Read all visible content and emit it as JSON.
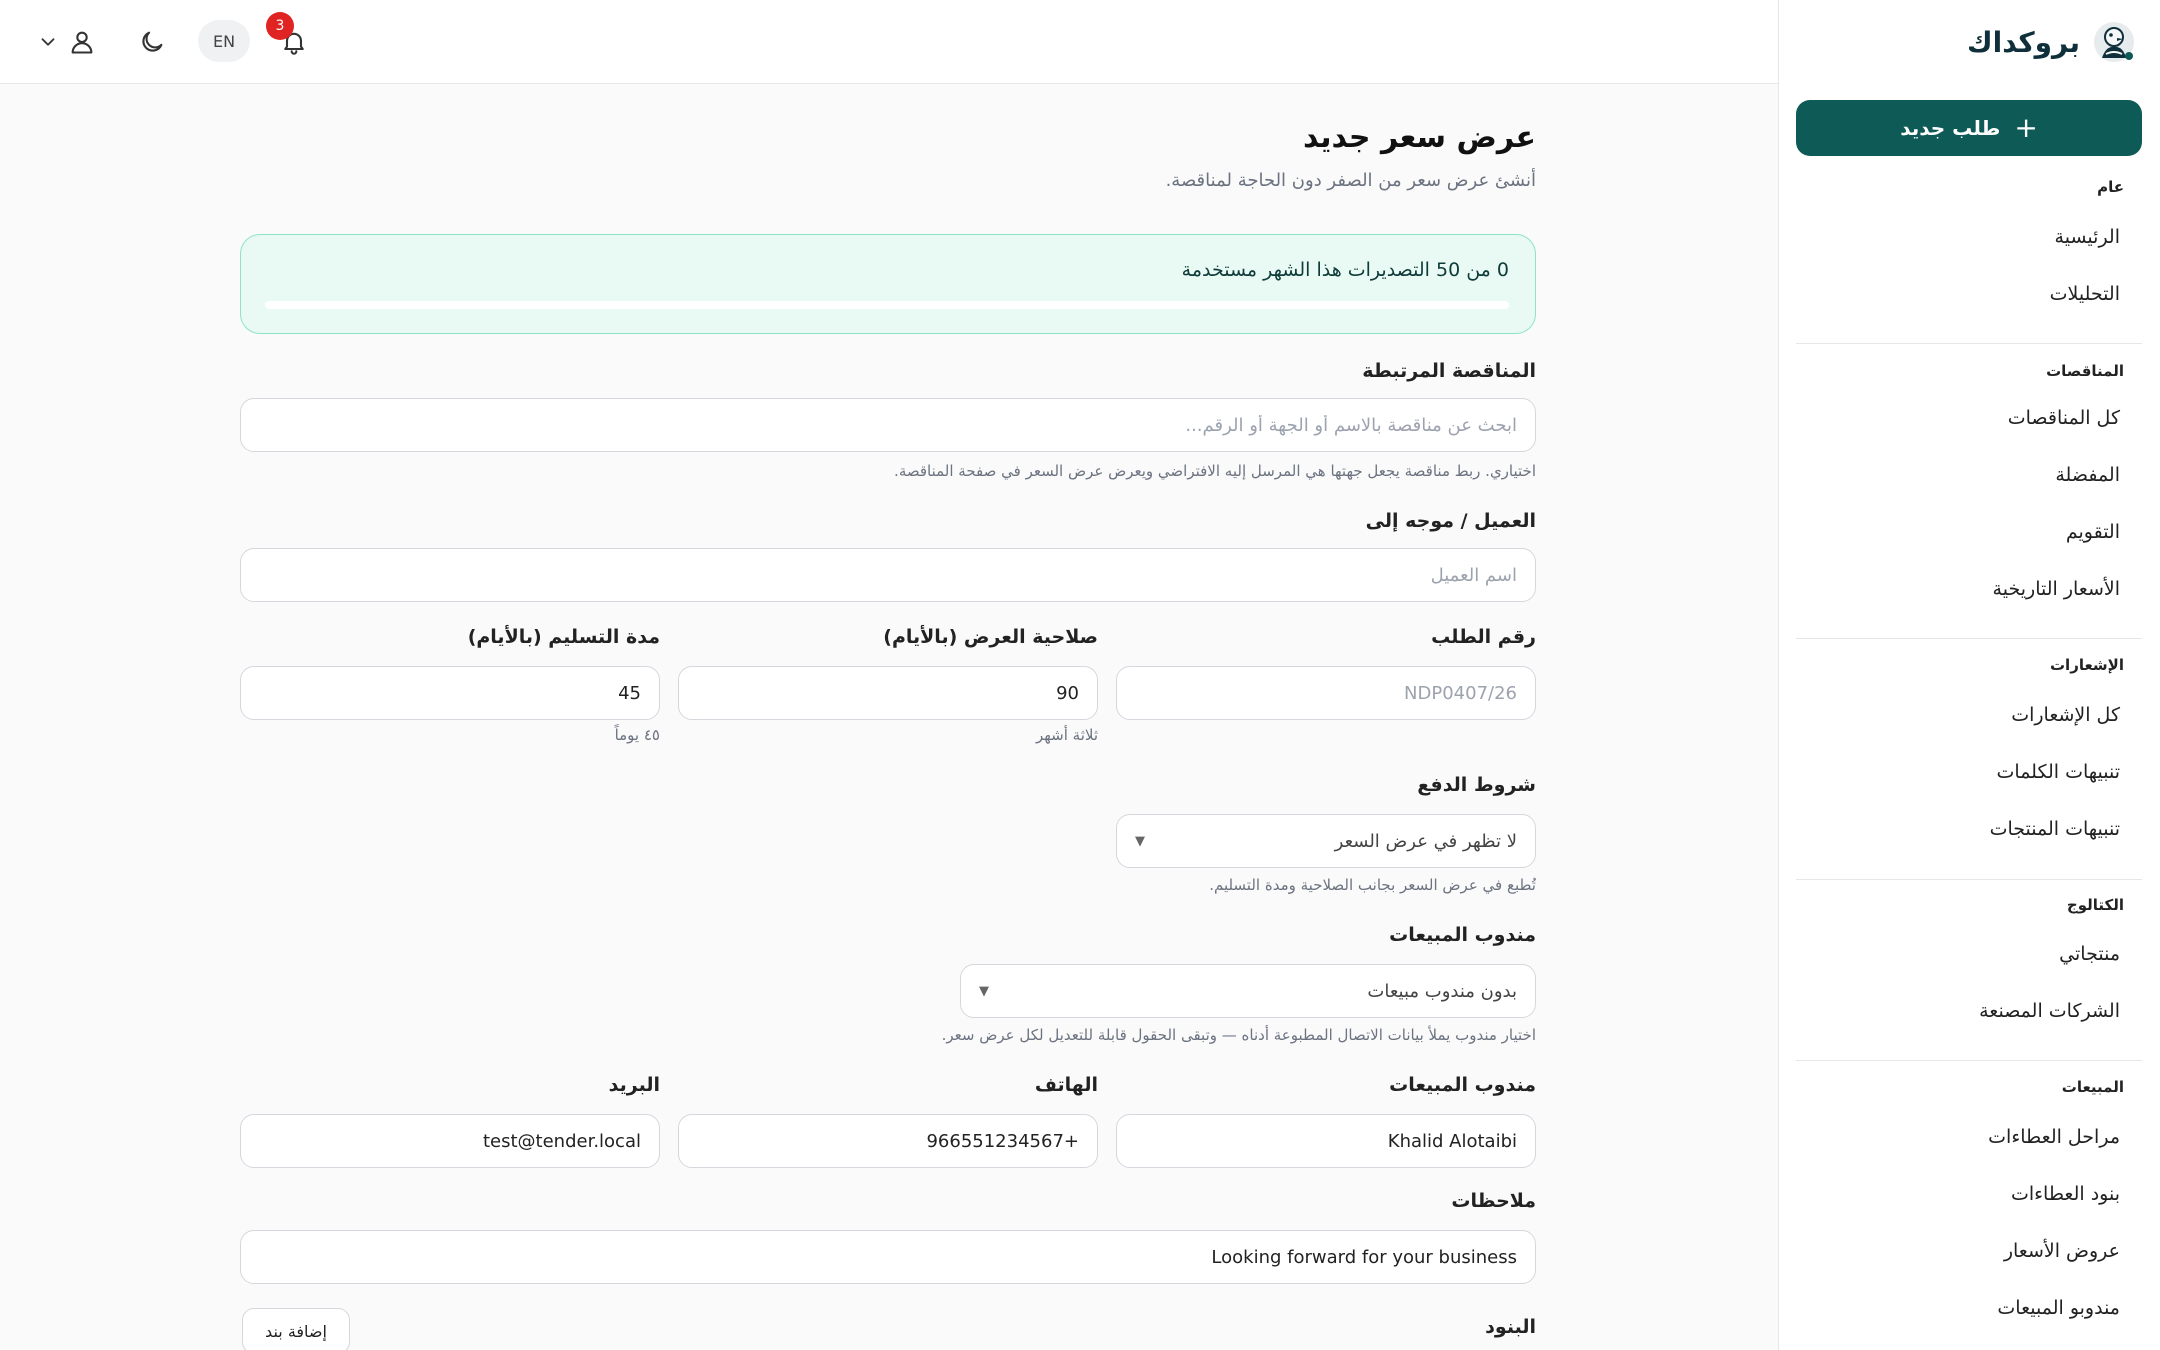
{
  "brand": {
    "name": "بروكداك",
    "logo_icon": "duck-logo-icon"
  },
  "sidebar": {
    "new_request_label": "طلب جديد",
    "sections": [
      {
        "heading": "عام",
        "items": [
          "الرئيسية",
          "التحليلات"
        ]
      },
      {
        "heading": "المناقصات",
        "items": [
          "كل المناقصات",
          "المفضلة",
          "التقويم",
          "الأسعار التاريخية"
        ]
      },
      {
        "heading": "الإشعارات",
        "items": [
          "كل الإشعارات",
          "تنبيهات الكلمات",
          "تنبيهات المنتجات"
        ]
      },
      {
        "heading": "الكتالوج",
        "items": [
          "منتجاتي",
          "الشركات المصنعة"
        ]
      },
      {
        "heading": "المبيعات",
        "items": [
          "مراحل العطاءات",
          "بنود العطاءات",
          "عروض الأسعار",
          "مندوبو المبيعات"
        ]
      }
    ]
  },
  "topbar": {
    "notification_count": "3",
    "language_label": "EN",
    "icons": [
      "bell-icon",
      "moon-icon",
      "user-icon",
      "chevron-down-icon"
    ]
  },
  "page": {
    "title": "عرض سعر جديد",
    "subtitle": "أنشئ عرض سعر من الصفر دون الحاجة لمناقصة."
  },
  "usage": {
    "text": "0 من 50 التصديرات هذا الشهر مستخدمة",
    "used": 0,
    "limit": 50
  },
  "form": {
    "tender": {
      "label": "المناقصة المرتبطة",
      "placeholder": "ابحث عن مناقصة بالاسم أو الجهة أو الرقم...",
      "helper": "اختياري. ربط مناقصة يجعل جهتها هي المرسل إليه الافتراضي ويعرض عرض السعر في صفحة المناقصة."
    },
    "client": {
      "label": "العميل / موجه إلى",
      "placeholder": "اسم العميل"
    },
    "request_number": {
      "label": "رقم الطلب",
      "placeholder": "NDP0407/26"
    },
    "validity": {
      "label": "صلاحية العرض (بالأيام)",
      "value": "90",
      "helper": "ثلاثة أشهر"
    },
    "delivery": {
      "label": "مدة التسليم (بالأيام)",
      "value": "45",
      "helper": "٤٥ يوماً"
    },
    "payment_terms": {
      "label": "شروط الدفع",
      "selected": "لا تظهر في عرض السعر",
      "helper": "تُطبع في عرض السعر بجانب الصلاحية ومدة التسليم."
    },
    "sales_rep_select": {
      "label": "مندوب المبيعات",
      "selected": "بدون مندوب مبيعات",
      "helper": "اختيار مندوب يملأ بيانات الاتصال المطبوعة أدناه — وتبقى الحقول قابلة للتعديل لكل عرض سعر."
    },
    "rep_name": {
      "label": "مندوب المبيعات",
      "value": "Khalid Alotaibi"
    },
    "rep_phone": {
      "label": "الهاتف",
      "value": "+966551234567"
    },
    "rep_email": {
      "label": "البريد",
      "value": "test@tender.local"
    },
    "notes": {
      "label": "ملاحظات",
      "value": "Looking forward for your business"
    },
    "items": {
      "label": "البنود",
      "add_button": "إضافة بند"
    }
  },
  "colors": {
    "primary": "#0d5a56",
    "usage_bg": "#e8faf3",
    "usage_border": "#8ee3c4",
    "badge": "#e02424"
  }
}
